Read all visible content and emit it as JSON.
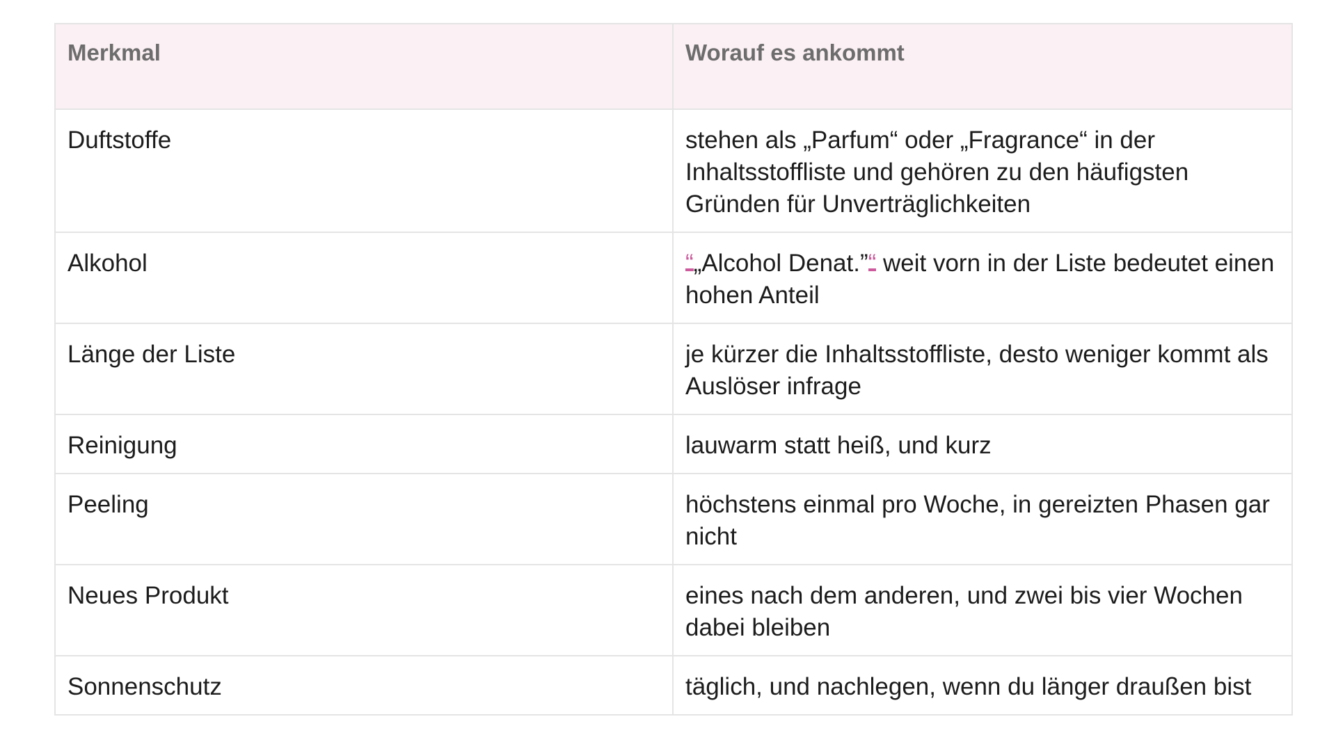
{
  "table": {
    "headers": [
      "Merkmal",
      "Worauf es ankommt"
    ],
    "rows": [
      {
        "feature": "Duftstoffe",
        "detail": "stehen als „Parfum“ oder „Fragrance“ in der Inhaltsstoffliste und gehören zu den häufigsten Gründen für Unverträglichkeiten"
      },
      {
        "feature": "Alkohol",
        "detail_mark_open": "“",
        "detail_pre": "„Alcohol Denat.”",
        "detail_mark_close": "“",
        "detail_post": " weit vorn in der Liste bedeutet einen hohen Anteil"
      },
      {
        "feature": "Länge der Liste",
        "detail": "je kürzer die Inhaltsstoffliste, desto weniger kommt als Auslöser infrage"
      },
      {
        "feature": "Reinigung",
        "detail": "lauwarm statt heiß, und kurz"
      },
      {
        "feature": "Peeling",
        "detail": "höchstens einmal pro Woche, in gereizten Phasen gar nicht"
      },
      {
        "feature": "Neues Produkt",
        "detail": "eines nach dem anderen, und zwei bis vier Wochen dabei bleiben"
      },
      {
        "feature": "Sonnenschutz",
        "detail": "täglich, und nachlegen, wenn du länger draußen bist"
      }
    ]
  },
  "colors": {
    "header_background": "#fbf0f3",
    "header_text": "#6d6d6d",
    "border": "#e4e4e4",
    "highlight_mark": "#cc5a9c"
  }
}
